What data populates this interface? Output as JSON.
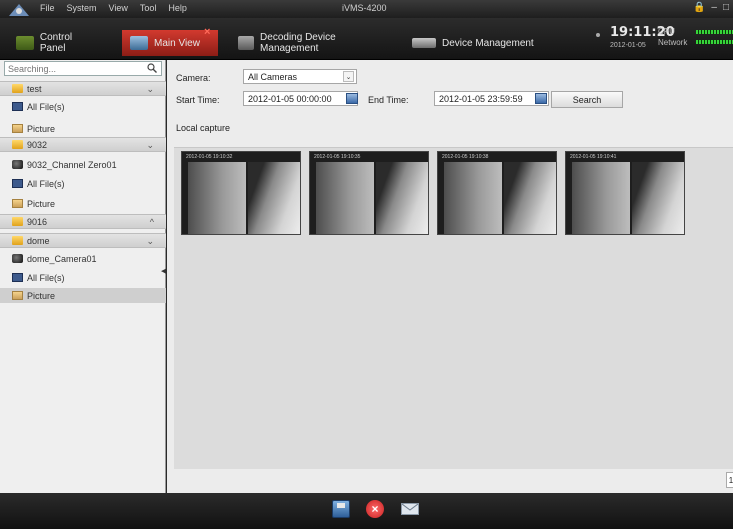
{
  "menubar": {
    "items": [
      "File",
      "System",
      "View",
      "Tool",
      "Help"
    ],
    "title": "iVMS-4200",
    "window_controls": [
      "lock-icon",
      "minimize-icon",
      "maximize-icon"
    ]
  },
  "tabs": [
    {
      "label": "Control Panel",
      "icon": "control-panel-icon",
      "active": false
    },
    {
      "label": "Main View",
      "icon": "main-view-icon",
      "active": true
    },
    {
      "label": "Decoding Device Management",
      "icon": "decoding-device-icon",
      "active": false
    },
    {
      "label": "Device Management",
      "icon": "device-management-icon",
      "active": false
    }
  ],
  "status": {
    "time": "19:11:20",
    "date": "2012-01-05",
    "cpu_label": "CPU",
    "network_label": "Network"
  },
  "sidebar": {
    "search_placeholder": "Searching...",
    "items": [
      {
        "label": "test",
        "type": "group",
        "icon": "folder-icon",
        "chevron": "⌄"
      },
      {
        "label": "All File(s)",
        "type": "item",
        "icon": "disk-icon"
      },
      {
        "label": "Picture",
        "type": "item",
        "icon": "picture-icon"
      },
      {
        "label": "9032",
        "type": "group",
        "icon": "folder-icon",
        "chevron": "⌄"
      },
      {
        "label": "9032_Channel Zero01",
        "type": "item",
        "icon": "camera-icon"
      },
      {
        "label": "All File(s)",
        "type": "item",
        "icon": "disk-icon"
      },
      {
        "label": "Picture",
        "type": "item",
        "icon": "picture-icon"
      },
      {
        "label": "9016",
        "type": "group",
        "icon": "folder-icon",
        "chevron": "^"
      },
      {
        "label": "dome",
        "type": "group",
        "icon": "folder-icon",
        "chevron": "⌄"
      },
      {
        "label": "dome_Camera01",
        "type": "item",
        "icon": "camera-icon"
      },
      {
        "label": "All File(s)",
        "type": "item",
        "icon": "disk-icon"
      },
      {
        "label": "Picture",
        "type": "item",
        "icon": "picture-icon",
        "selected": true
      }
    ]
  },
  "filters": {
    "camera_label": "Camera:",
    "camera_value": "All Cameras",
    "start_label": "Start Time:",
    "start_value": "2012-01-05 00:00:00",
    "end_label": "End Time:",
    "end_value": "2012-01-05 23:59:59",
    "search_label": "Search"
  },
  "capture": {
    "section_label": "Local capture",
    "thumbnails": [
      {
        "stamp": "2012-01-05 19:10:32",
        "label": ""
      },
      {
        "stamp": "2012-01-05 19:10:35",
        "label": ""
      },
      {
        "stamp": "2012-01-05 19:10:38",
        "label": ""
      },
      {
        "stamp": "2012-01-05 19:10:41",
        "label": ""
      }
    ],
    "page": "1"
  },
  "bottombar": {
    "buttons": [
      "save-icon",
      "delete-icon",
      "email-icon"
    ]
  }
}
